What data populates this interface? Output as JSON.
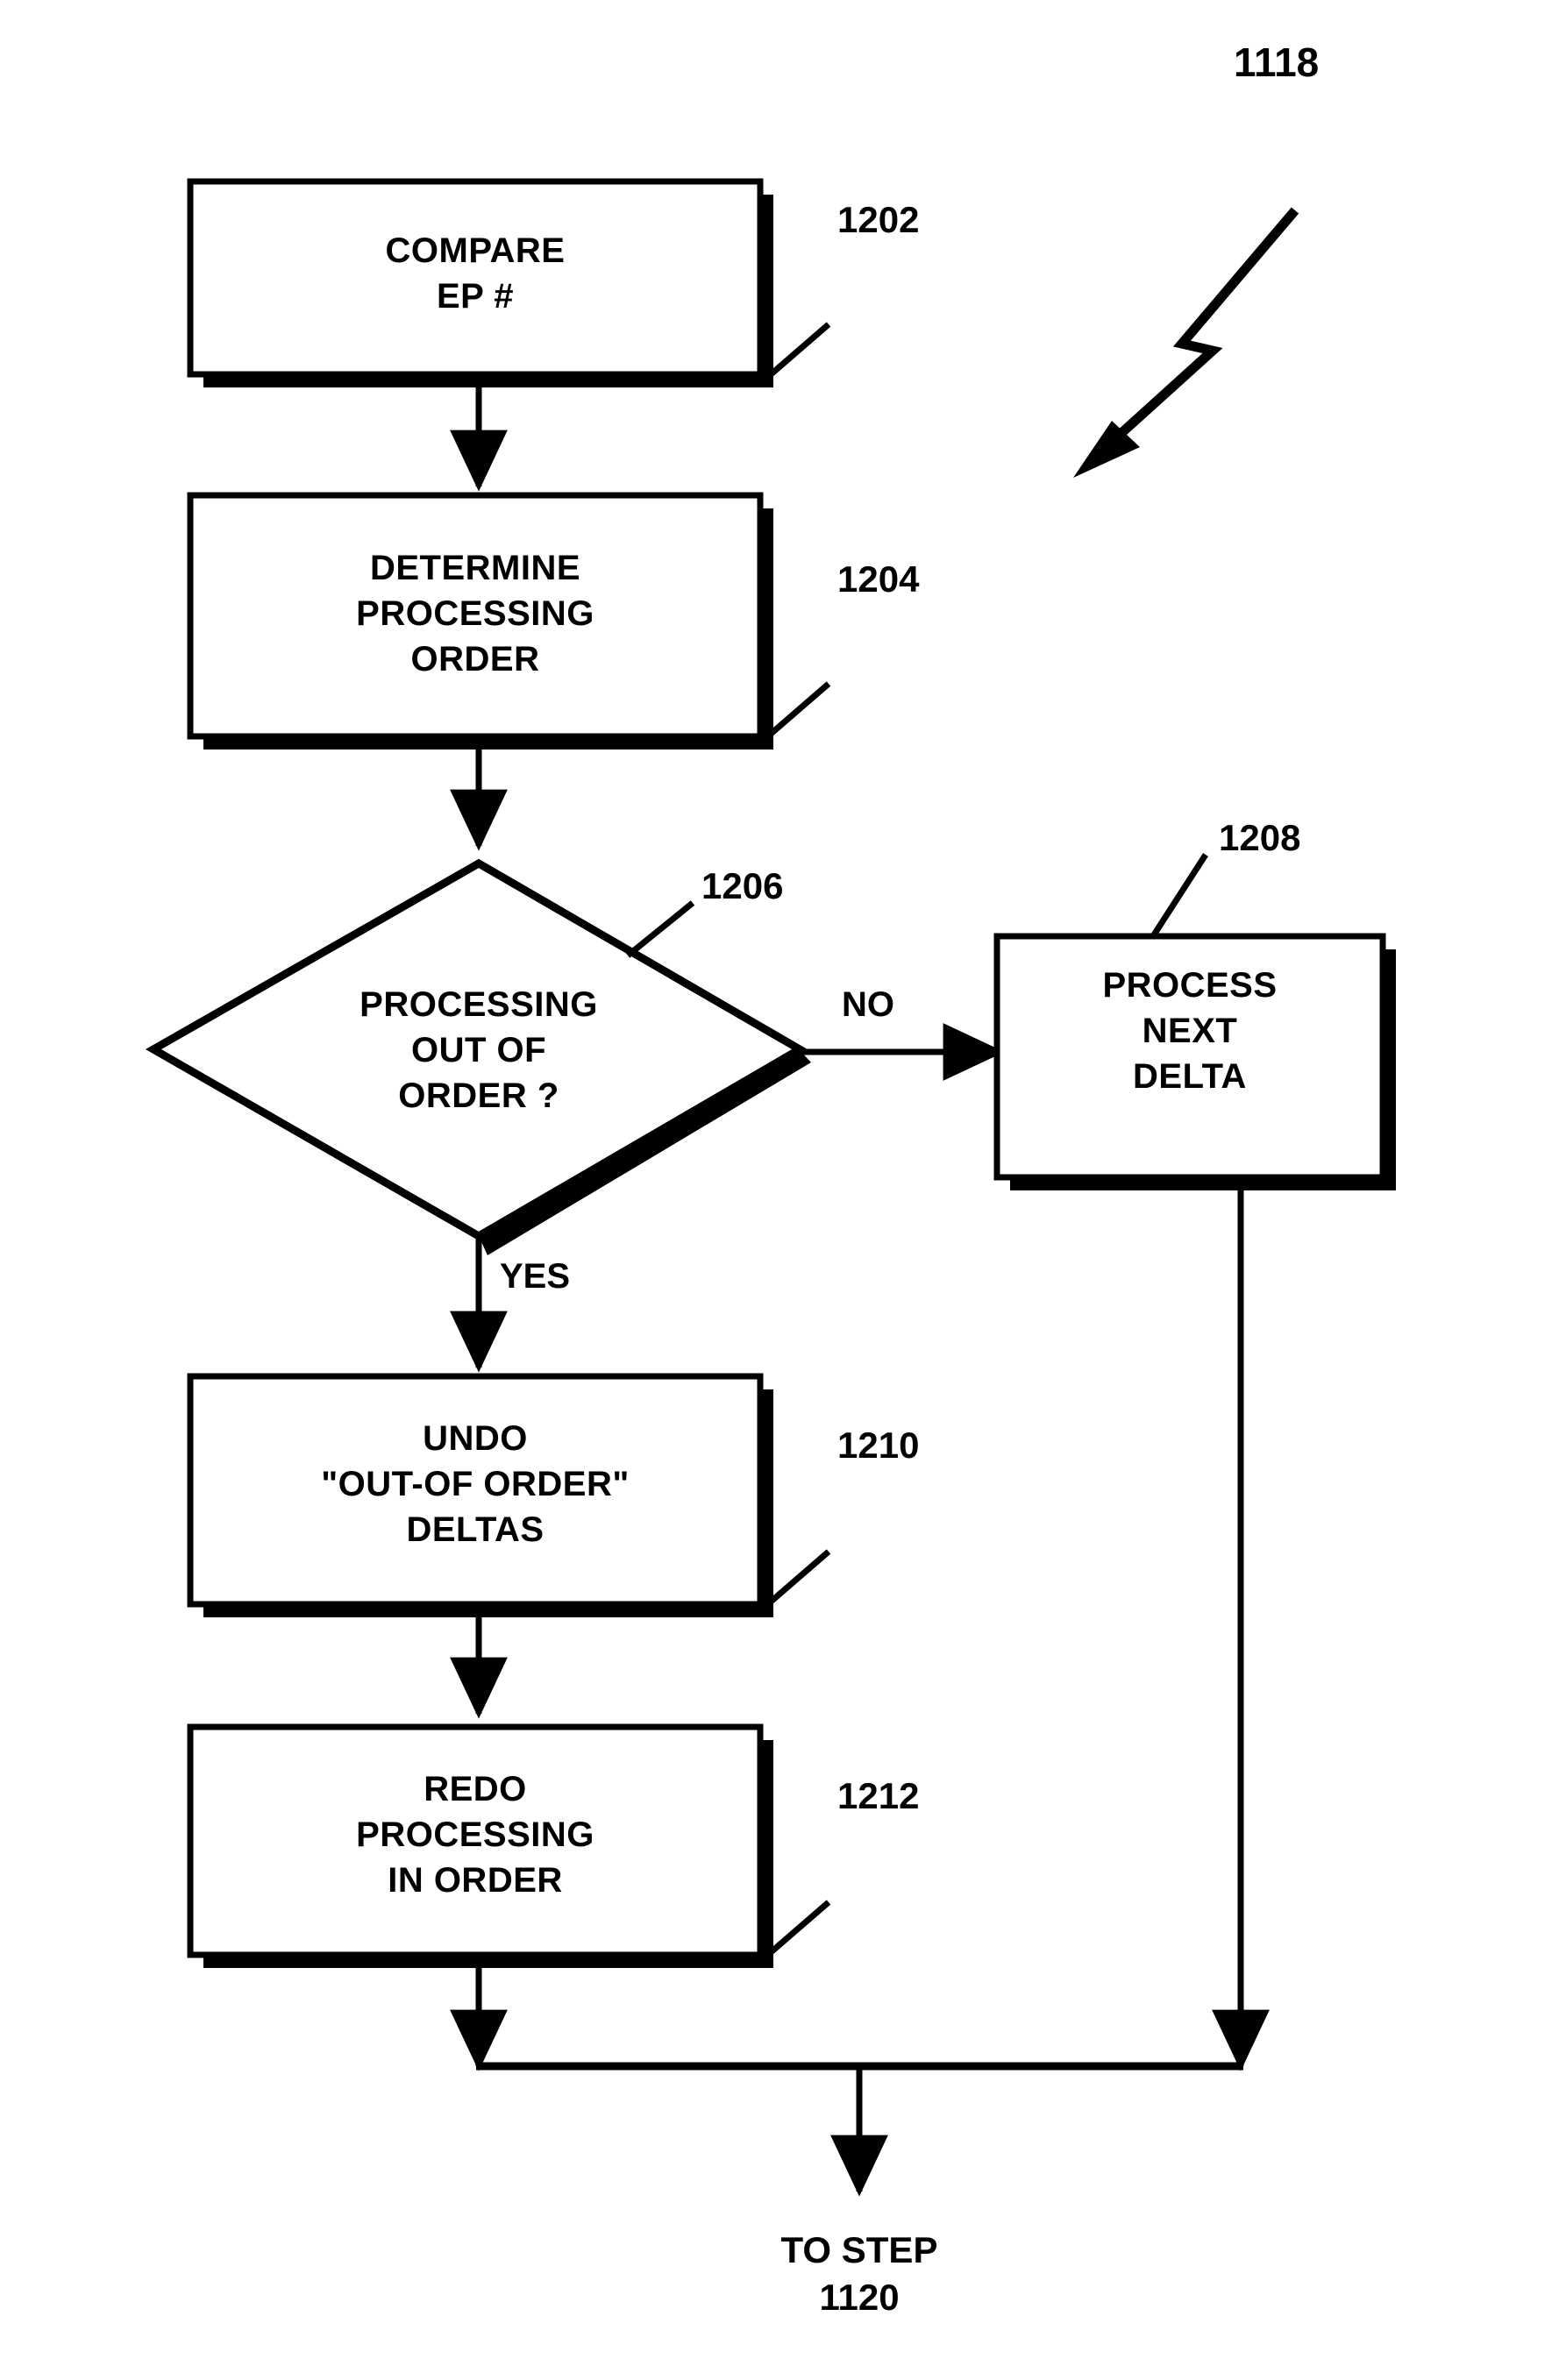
{
  "figure": {
    "figure_ref": "1118",
    "background_color": "#ffffff",
    "ink_color": "#000000"
  },
  "nodes": [
    {
      "id": "compare-ep",
      "shape": "process-box",
      "text": "COMPARE\nEP #",
      "ref": "1202"
    },
    {
      "id": "determine-processing-order",
      "shape": "process-box",
      "text": "DETERMINE\nPROCESSING\nORDER",
      "ref": "1204"
    },
    {
      "id": "processing-out-of-order",
      "shape": "decision-diamond",
      "text": "PROCESSING\nOUT OF\nORDER ?",
      "ref": "1206"
    },
    {
      "id": "process-next-delta",
      "shape": "process-box",
      "text": "PROCESS\nNEXT\nDELTA",
      "ref": "1208"
    },
    {
      "id": "undo-out-of-order-deltas",
      "shape": "process-box",
      "text": "UNDO\n\"OUT-OF ORDER\"\nDELTAS",
      "ref": "1210"
    },
    {
      "id": "redo-processing-in-order",
      "shape": "process-box",
      "text": "REDO\nPROCESSING\nIN ORDER",
      "ref": "1212"
    }
  ],
  "edge_labels": {
    "no_branch": "NO",
    "yes_branch": "YES"
  },
  "terminal": {
    "text": "TO STEP\n1120"
  },
  "chart_data": {
    "type": "flowchart",
    "title": "1118",
    "nodes": [
      {
        "ref": "1202",
        "label": "COMPARE EP #",
        "type": "process"
      },
      {
        "ref": "1204",
        "label": "DETERMINE PROCESSING ORDER",
        "type": "process"
      },
      {
        "ref": "1206",
        "label": "PROCESSING OUT OF ORDER ?",
        "type": "decision"
      },
      {
        "ref": "1208",
        "label": "PROCESS NEXT DELTA",
        "type": "process"
      },
      {
        "ref": "1210",
        "label": "UNDO \"OUT-OF ORDER\" DELTAS",
        "type": "process"
      },
      {
        "ref": "1212",
        "label": "REDO PROCESSING IN ORDER",
        "type": "process"
      }
    ],
    "edges": [
      {
        "from": "1202",
        "to": "1204",
        "label": ""
      },
      {
        "from": "1204",
        "to": "1206",
        "label": ""
      },
      {
        "from": "1206",
        "to": "1208",
        "label": "NO"
      },
      {
        "from": "1206",
        "to": "1210",
        "label": "YES"
      },
      {
        "from": "1210",
        "to": "1212",
        "label": ""
      },
      {
        "from": "1212",
        "to": "TO STEP 1120",
        "label": ""
      },
      {
        "from": "1208",
        "to": "TO STEP 1120",
        "label": ""
      }
    ]
  }
}
